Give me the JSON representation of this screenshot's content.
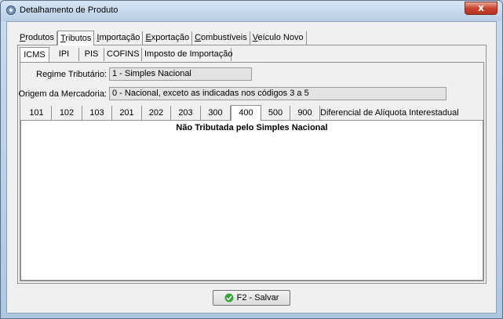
{
  "window": {
    "title": "Detalhamento de Produto",
    "close_label": "x"
  },
  "main_tabs": [
    {
      "pre": "",
      "key": "P",
      "rest": "rodutos"
    },
    {
      "pre": "",
      "key": "T",
      "rest": "ributos"
    },
    {
      "pre": "",
      "key": "I",
      "rest": "mportação"
    },
    {
      "pre": "",
      "key": "E",
      "rest": "xportação"
    },
    {
      "pre": "",
      "key": "C",
      "rest": "ombustíveis"
    },
    {
      "pre": "",
      "key": "V",
      "rest": "eículo Novo"
    }
  ],
  "tax_tabs": [
    "ICMS",
    "IPI",
    "PIS",
    "COFINS",
    "Imposto de Importação"
  ],
  "form": {
    "regime_label": "Regime Tributário:",
    "regime_value": "1 - Simples Nacional",
    "origem_label": "Origem da Mercadoria:",
    "origem_value": "0 - Nacional, exceto as indicadas nos códigos 3 a 5"
  },
  "cst_tabs": [
    "101",
    "102",
    "103",
    "201",
    "202",
    "203",
    "300",
    "400",
    "500",
    "900",
    "Diferencial de Alíquota Interestadual"
  ],
  "content": {
    "title": "Não Tributada pelo Simples Nacional"
  },
  "save_button": {
    "label": "F2 - Salvar"
  },
  "colors": {
    "accent_check": "#3aa53a",
    "close_button": "#c7452f"
  }
}
